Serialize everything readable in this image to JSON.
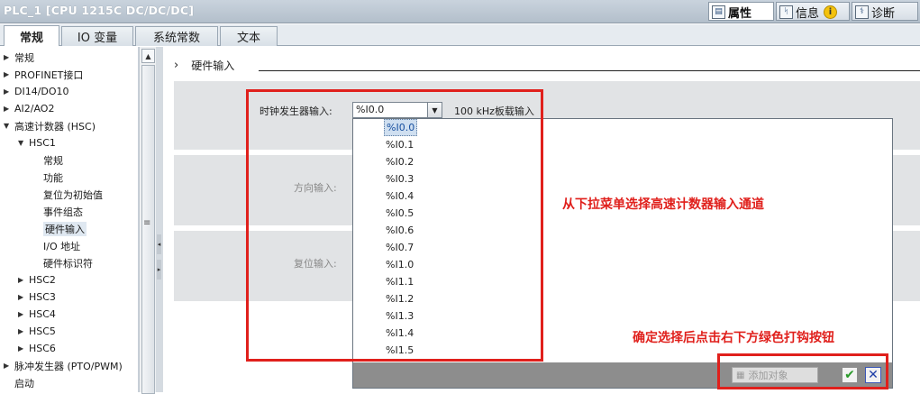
{
  "window": {
    "title": "PLC_1 [CPU 1215C DC/DC/DC]",
    "inspector_tabs": [
      {
        "label": "属性",
        "icon": "properties-icon",
        "active": true
      },
      {
        "label": "信息",
        "icon": "info-icon",
        "active": false
      },
      {
        "label": "诊断",
        "icon": "diagnostics-icon",
        "active": false
      }
    ],
    "info_badge": "i"
  },
  "tabs": [
    {
      "label": "常规",
      "active": true
    },
    {
      "label": "IO 变量",
      "active": false
    },
    {
      "label": "系统常数",
      "active": false
    },
    {
      "label": "文本",
      "active": false
    }
  ],
  "tree": [
    {
      "label": "常规",
      "level": 0,
      "expander": "▶"
    },
    {
      "label": "PROFINET接口",
      "level": 0,
      "expander": "▶"
    },
    {
      "label": "DI14/DO10",
      "level": 0,
      "expander": "▶"
    },
    {
      "label": "AI2/AO2",
      "level": 0,
      "expander": "▶"
    },
    {
      "label": "高速计数器 (HSC)",
      "level": 0,
      "expander": "▼"
    },
    {
      "label": "HSC1",
      "level": 1,
      "expander": "▼"
    },
    {
      "label": "常规",
      "level": 2,
      "expander": ""
    },
    {
      "label": "功能",
      "level": 2,
      "expander": ""
    },
    {
      "label": "复位为初始值",
      "level": 2,
      "expander": ""
    },
    {
      "label": "事件组态",
      "level": 2,
      "expander": ""
    },
    {
      "label": "硬件输入",
      "level": 2,
      "expander": "",
      "selected": true
    },
    {
      "label": "I/O 地址",
      "level": 2,
      "expander": ""
    },
    {
      "label": "硬件标识符",
      "level": 2,
      "expander": ""
    },
    {
      "label": "HSC2",
      "level": 1,
      "expander": "▶"
    },
    {
      "label": "HSC3",
      "level": 1,
      "expander": "▶"
    },
    {
      "label": "HSC4",
      "level": 1,
      "expander": "▶"
    },
    {
      "label": "HSC5",
      "level": 1,
      "expander": "▶"
    },
    {
      "label": "HSC6",
      "level": 1,
      "expander": "▶"
    },
    {
      "label": "脉冲发生器 (PTO/PWM)",
      "level": 0,
      "expander": "▶"
    },
    {
      "label": "启动",
      "level": 0,
      "expander": ""
    }
  ],
  "content": {
    "section_title": "硬件输入",
    "section_chevron": "›",
    "clock_label": "时钟发生器输入:",
    "clock_value": "%I0.0",
    "clock_info": "100 kHz板载输入",
    "direction_label": "方向输入:",
    "reset_label": "复位输入:"
  },
  "dropdown": {
    "items": [
      "%I0.0",
      "%I0.1",
      "%I0.2",
      "%I0.3",
      "%I0.4",
      "%I0.5",
      "%I0.6",
      "%I0.7",
      "%I1.0",
      "%I1.1",
      "%I1.2",
      "%I1.3",
      "%I1.4",
      "%I1.5"
    ],
    "selected_index": 0,
    "add_object_label": "添加对象",
    "ok_symbol": "✔",
    "cancel_symbol": "✕"
  },
  "annotations": {
    "dropdown_hint": "从下拉菜单选择高速计数器输入通道",
    "confirm_hint": "确定选择后点击右下方绿色打钩按钮"
  },
  "colors": {
    "annotation_red": "#e0201c",
    "confirm_green": "#2a9a2a",
    "cancel_blue": "#1f3fa8"
  }
}
